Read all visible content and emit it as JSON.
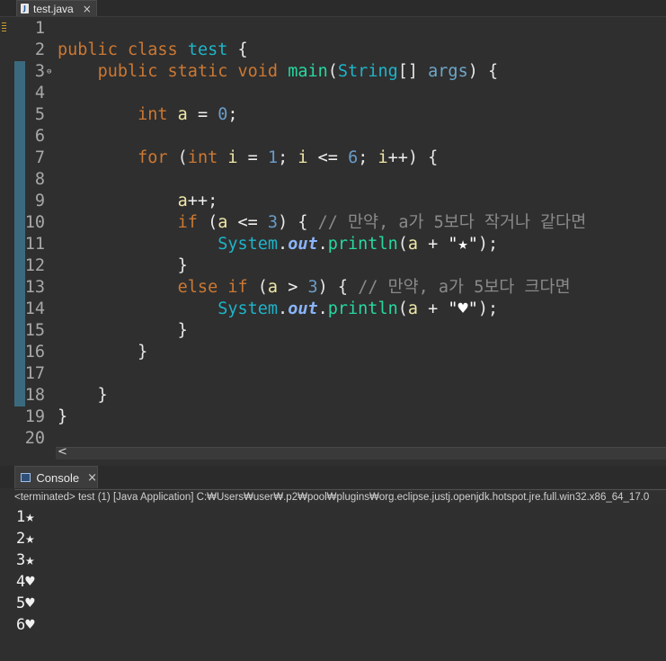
{
  "editor": {
    "tab": {
      "title": "test.java",
      "icon": "java-file-icon",
      "close": "×"
    },
    "lines": [
      {
        "n": "1"
      },
      {
        "n": "2",
        "t": [
          [
            "kw",
            "public"
          ],
          [
            "nm",
            " "
          ],
          [
            "kw",
            "class"
          ],
          [
            "nm",
            " "
          ],
          [
            "cls",
            "test"
          ],
          [
            "nm",
            " {"
          ]
        ]
      },
      {
        "n": "3",
        "fold": true,
        "t": [
          [
            "nm",
            "    "
          ],
          [
            "kw",
            "public"
          ],
          [
            "nm",
            " "
          ],
          [
            "kw",
            "static"
          ],
          [
            "nm",
            " "
          ],
          [
            "kw",
            "void"
          ],
          [
            "nm",
            " "
          ],
          [
            "fn",
            "main"
          ],
          [
            "nm",
            "("
          ],
          [
            "cls",
            "String"
          ],
          [
            "nm",
            "[] "
          ],
          [
            "ty",
            "args"
          ],
          [
            "nm",
            ") {"
          ]
        ]
      },
      {
        "n": "4"
      },
      {
        "n": "5",
        "t": [
          [
            "nm",
            "        "
          ],
          [
            "kw",
            "int"
          ],
          [
            "nm",
            " "
          ],
          [
            "var",
            "a"
          ],
          [
            "op",
            " = "
          ],
          [
            "num",
            "0"
          ],
          [
            "nm",
            ";"
          ]
        ]
      },
      {
        "n": "6"
      },
      {
        "n": "7",
        "t": [
          [
            "nm",
            "        "
          ],
          [
            "kw",
            "for"
          ],
          [
            "nm",
            " ("
          ],
          [
            "kw",
            "int"
          ],
          [
            "nm",
            " "
          ],
          [
            "var",
            "i"
          ],
          [
            "op",
            " = "
          ],
          [
            "num",
            "1"
          ],
          [
            "nm",
            "; "
          ],
          [
            "var",
            "i"
          ],
          [
            "op",
            " <= "
          ],
          [
            "num",
            "6"
          ],
          [
            "nm",
            "; "
          ],
          [
            "var",
            "i"
          ],
          [
            "op",
            "++"
          ],
          [
            "nm",
            ") {"
          ]
        ]
      },
      {
        "n": "8"
      },
      {
        "n": "9",
        "t": [
          [
            "nm",
            "            "
          ],
          [
            "var",
            "a"
          ],
          [
            "op",
            "++"
          ],
          [
            "nm",
            ";"
          ]
        ]
      },
      {
        "n": "10",
        "t": [
          [
            "nm",
            "            "
          ],
          [
            "kw",
            "if"
          ],
          [
            "nm",
            " ("
          ],
          [
            "var",
            "a"
          ],
          [
            "op",
            " <= "
          ],
          [
            "num",
            "3"
          ],
          [
            "nm",
            ") { "
          ],
          [
            "cm",
            "// 만약, a가 5보다 작거나 같다면"
          ]
        ]
      },
      {
        "n": "11",
        "t": [
          [
            "nm",
            "                "
          ],
          [
            "cls",
            "System"
          ],
          [
            "nm",
            "."
          ],
          [
            "fld",
            "out"
          ],
          [
            "nm",
            "."
          ],
          [
            "fn",
            "println"
          ],
          [
            "nm",
            "("
          ],
          [
            "var",
            "a"
          ],
          [
            "op",
            " + "
          ],
          [
            "str",
            "\"★\""
          ],
          [
            "nm",
            ");"
          ]
        ]
      },
      {
        "n": "12",
        "t": [
          [
            "nm",
            "            }"
          ]
        ]
      },
      {
        "n": "13",
        "t": [
          [
            "nm",
            "            "
          ],
          [
            "kw",
            "else"
          ],
          [
            "nm",
            " "
          ],
          [
            "kw",
            "if"
          ],
          [
            "nm",
            " ("
          ],
          [
            "var",
            "a"
          ],
          [
            "op",
            " > "
          ],
          [
            "num",
            "3"
          ],
          [
            "nm",
            ") { "
          ],
          [
            "cm",
            "// 만약, a가 5보다 크다면"
          ]
        ]
      },
      {
        "n": "14",
        "t": [
          [
            "nm",
            "                "
          ],
          [
            "cls",
            "System"
          ],
          [
            "nm",
            "."
          ],
          [
            "fld",
            "out"
          ],
          [
            "nm",
            "."
          ],
          [
            "fn",
            "println"
          ],
          [
            "nm",
            "("
          ],
          [
            "var",
            "a"
          ],
          [
            "op",
            " + "
          ],
          [
            "str",
            "\"♥\""
          ],
          [
            "nm",
            ");"
          ]
        ]
      },
      {
        "n": "15",
        "t": [
          [
            "nm",
            "            }"
          ]
        ]
      },
      {
        "n": "16",
        "t": [
          [
            "nm",
            "        }"
          ]
        ]
      },
      {
        "n": "17"
      },
      {
        "n": "18",
        "t": [
          [
            "nm",
            "    }"
          ]
        ]
      },
      {
        "n": "19",
        "t": [
          [
            "nm",
            "}"
          ]
        ]
      },
      {
        "n": "20"
      }
    ],
    "scroll_left_glyph": "<"
  },
  "console": {
    "tab": {
      "title": "Console",
      "icon": "console-icon",
      "close": "×"
    },
    "status": "<terminated> test (1) [Java Application] C:₩Users₩user₩.p2₩pool₩plugins₩org.eclipse.justj.openjdk.hotspot.jre.full.win32.x86_64_17.0",
    "output": [
      "1★",
      "2★",
      "3★",
      "4♥",
      "5♥",
      "6♥"
    ]
  }
}
